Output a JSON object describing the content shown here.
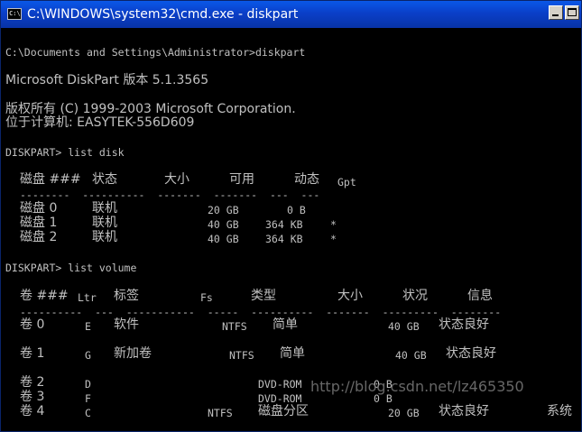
{
  "window": {
    "title": "C:\\WINDOWS\\system32\\cmd.exe - diskpart",
    "icon_text": "C:\\"
  },
  "console": {
    "prompt_line": "C:\\Documents and Settings\\Administrator>diskpart",
    "version_line": "Microsoft DiskPart 版本 5.1.3565",
    "copyright_line": "版权所有 (C) 1999-2003 Microsoft Corporation.",
    "computer_line": "位于计算机: EASYTEK-556D609",
    "cmd_list_disk": "DISKPART> list disk",
    "disk_headers": [
      "磁盘 ###",
      "状态",
      "大小",
      "可用",
      "动态",
      "Gpt"
    ],
    "disk_rule": "--------  ----------  -------  -------  ---  ---",
    "disks": [
      {
        "id": "磁盘 0",
        "status": "联机",
        "size": "20 GB",
        "free": "0 B",
        "dyn": "",
        "gpt": ""
      },
      {
        "id": "磁盘 1",
        "status": "联机",
        "size": "40 GB",
        "free": "364 KB",
        "dyn": "*",
        "gpt": ""
      },
      {
        "id": "磁盘 2",
        "status": "联机",
        "size": "40 GB",
        "free": "364 KB",
        "dyn": "*",
        "gpt": ""
      }
    ],
    "cmd_list_volume": "DISKPART> list volume",
    "volume_headers": [
      "卷 ###",
      "Ltr",
      "标签",
      "Fs",
      "类型",
      "大小",
      "状况",
      "信息"
    ],
    "volume_rule": "----------  ---  -----------  -----  ----------  -------  ---------  --------",
    "volumes": [
      {
        "id": "卷 0",
        "ltr": "E",
        "label": "软件",
        "fs": "NTFS",
        "type": "简单",
        "size": "40 GB",
        "status": "状态良好",
        "info": ""
      },
      {
        "id": "卷 1",
        "ltr": "G",
        "label": "新加卷",
        "fs": "NTFS",
        "type": "简单",
        "size": "40 GB",
        "status": "状态良好",
        "info": ""
      },
      {
        "id": "卷 2",
        "ltr": "D",
        "label": "",
        "fs": "",
        "type": "DVD-ROM",
        "size": "0 B",
        "status": "",
        "info": ""
      },
      {
        "id": "卷 3",
        "ltr": "F",
        "label": "",
        "fs": "",
        "type": "DVD-ROM",
        "size": "0 B",
        "status": "",
        "info": ""
      },
      {
        "id": "卷 4",
        "ltr": "C",
        "label": "",
        "fs": "NTFS",
        "type": "磁盘分区",
        "size": "20 GB",
        "status": "状态良好",
        "info": "系统"
      }
    ]
  },
  "watermark": "http://blog.csdn.net/lz465350"
}
